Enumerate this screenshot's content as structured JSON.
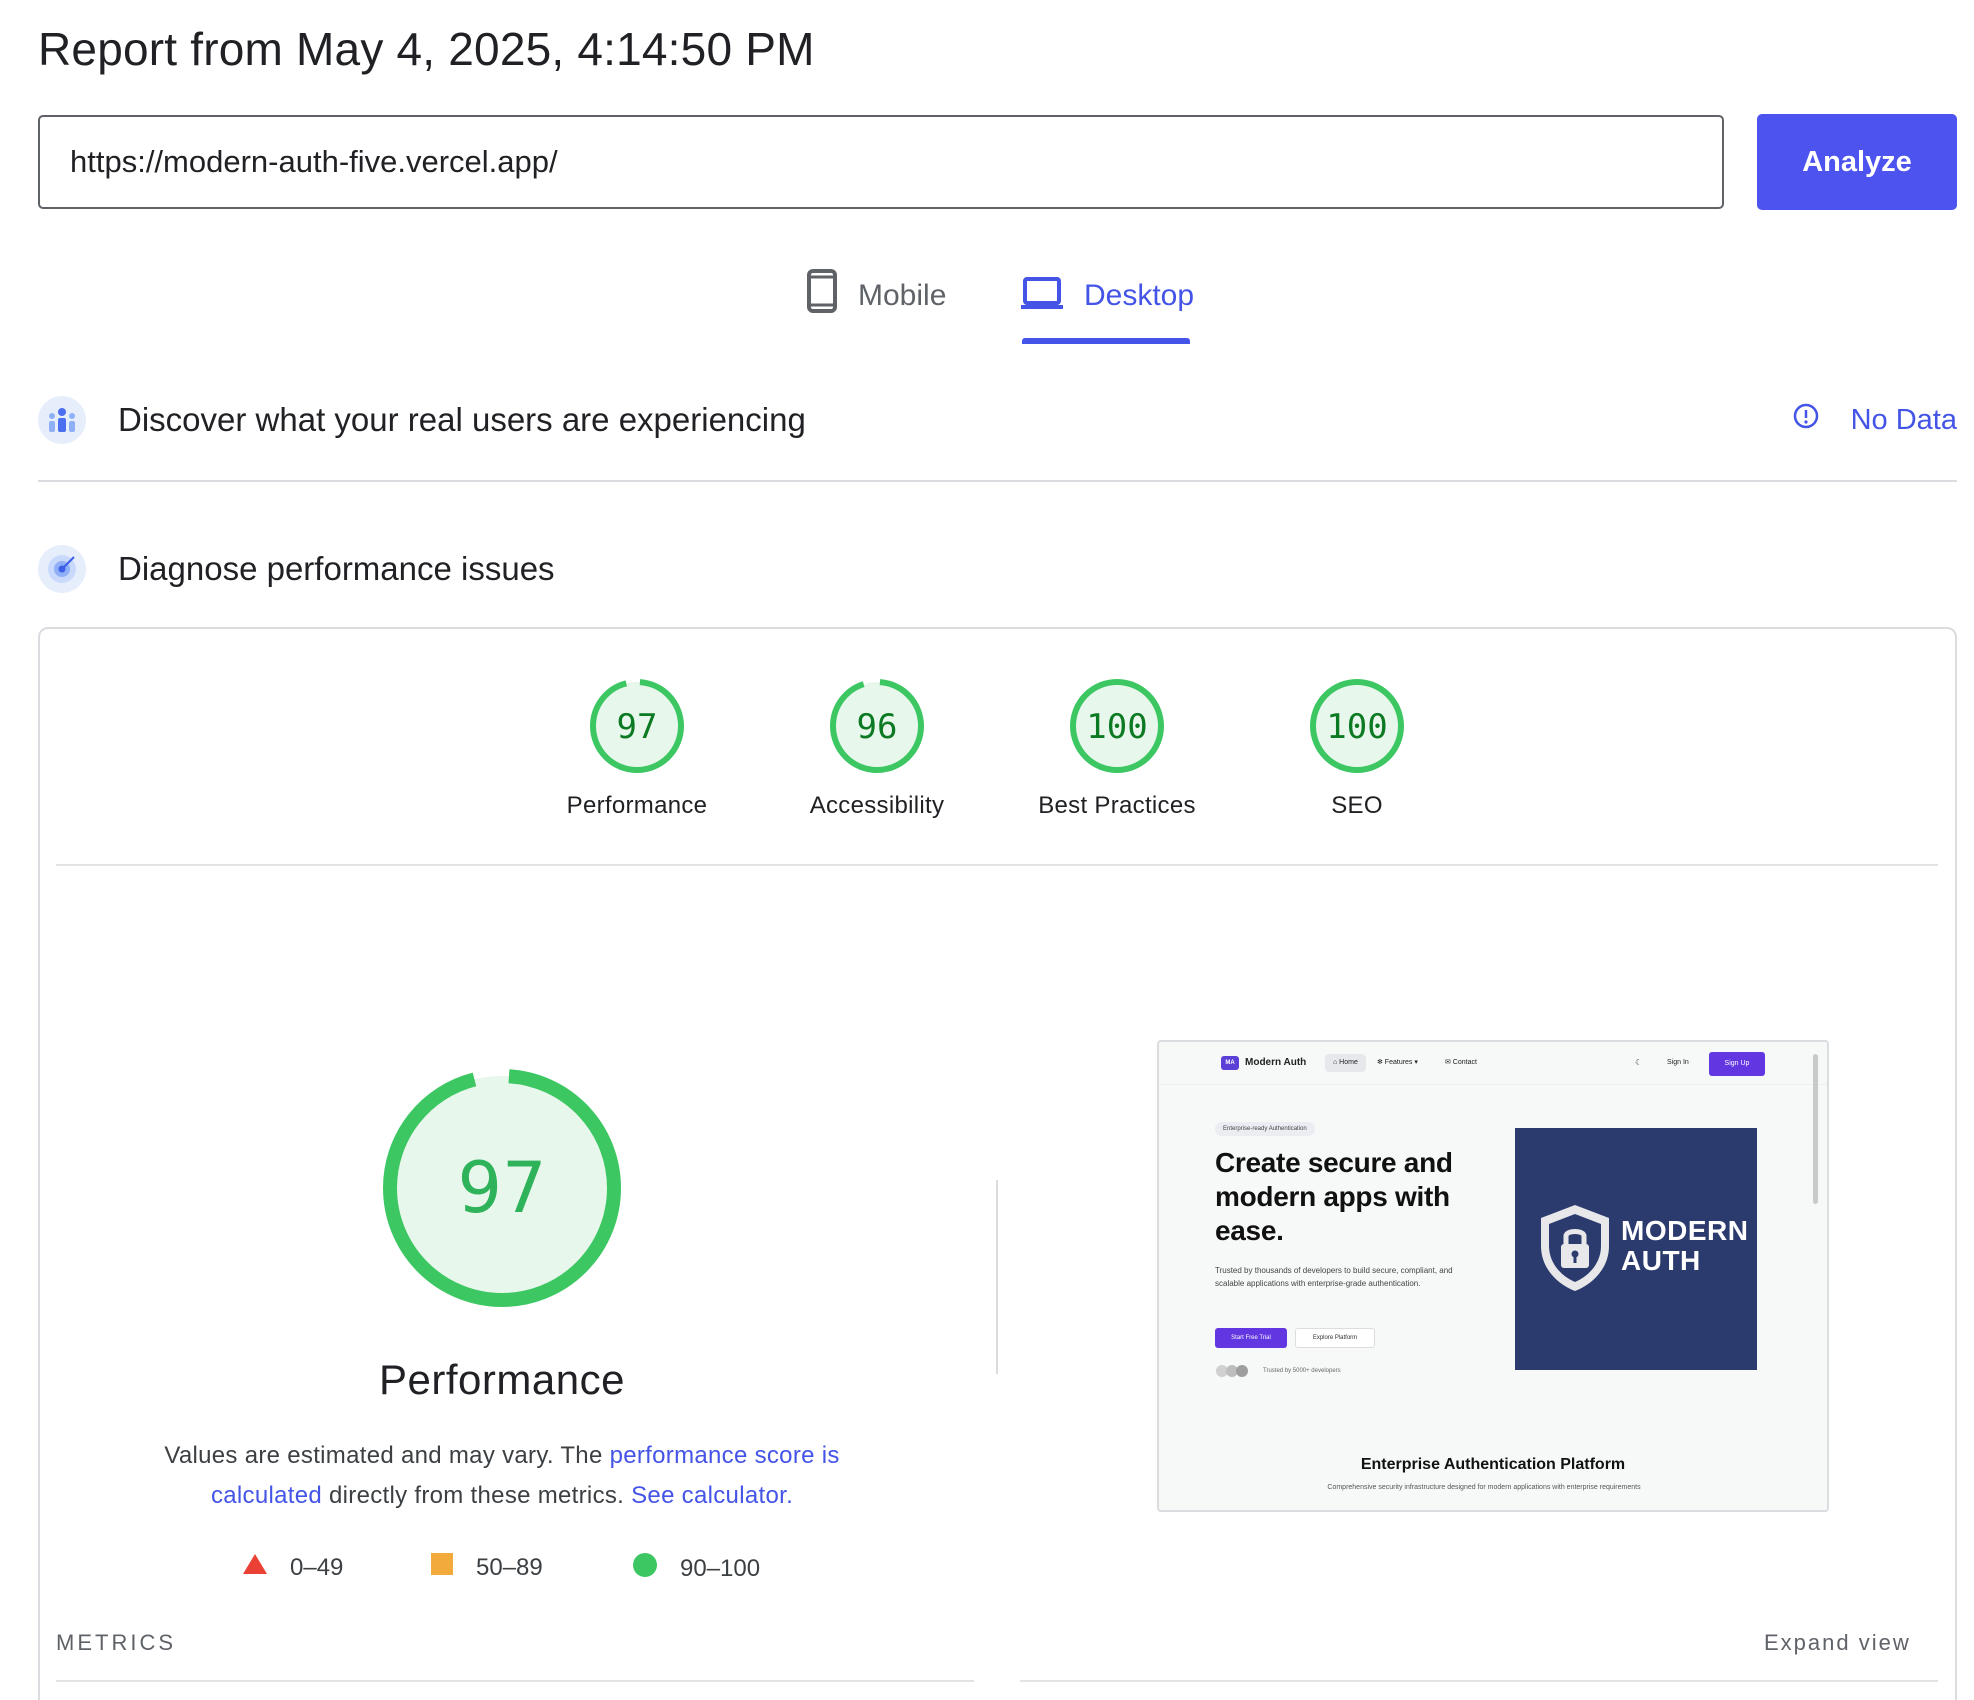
{
  "report_title": "Report from May 4, 2025, 4:14:50 PM",
  "url_input": {
    "value": "https://modern-auth-five.vercel.app/"
  },
  "analyze_label": "Analyze",
  "tabs": [
    {
      "label": "Mobile",
      "icon": "smartphone-icon",
      "selected": false
    },
    {
      "label": "Desktop",
      "icon": "laptop-icon",
      "selected": true
    }
  ],
  "real_users": {
    "title": "Discover what your real users are experiencing",
    "status": "No Data",
    "status_icon": "info-icon"
  },
  "diagnose": {
    "title": "Diagnose performance issues"
  },
  "scores": [
    {
      "value": "97",
      "label": "Performance",
      "fraction": 0.97
    },
    {
      "value": "96",
      "label": "Accessibility",
      "fraction": 0.96
    },
    {
      "value": "100",
      "label": "Best Practices",
      "fraction": 1.0
    },
    {
      "value": "100",
      "label": "SEO",
      "fraction": 1.0
    }
  ],
  "performance": {
    "score": "97",
    "fraction": 0.97,
    "title": "Performance",
    "desc_part1": "Values are estimated and may vary. The ",
    "desc_link1": "performance score is calculated",
    "desc_part2": " directly from these metrics. ",
    "desc_link2": "See calculator."
  },
  "legend": [
    {
      "range": "0–49",
      "shape": "triangle",
      "color": "#eb4034"
    },
    {
      "range": "50–89",
      "shape": "square",
      "color": "#f2ab3a"
    },
    {
      "range": "90–100",
      "shape": "circle",
      "color": "#3cc762"
    }
  ],
  "metrics_label": "METRICS",
  "expand_view_label": "Expand view",
  "colors": {
    "accent": "#4454e6",
    "analyze_button": "#4c53ef",
    "pass_green": "#3cc762",
    "pass_text": "#0c7a22",
    "gauge_fill": "#e8f7ec"
  },
  "screenshot": {
    "logo_initials": "MA",
    "logo_text": "Modern Auth",
    "nav_home": "⌂ Home",
    "nav_features": "✻ Features ▾",
    "nav_contact": "✉ Contact",
    "nav_theme": "☾",
    "nav_signin": "Sign In",
    "nav_signup": "Sign Up",
    "badge": "Enterprise-ready Authentication",
    "headline": "Create secure and modern apps with ease.",
    "subtext": "Trusted by thousands of developers to build secure, compliant, and scalable applications with enterprise-grade authentication.",
    "cta_primary": "Start Free Trial",
    "cta_secondary": "Explore Platform",
    "trusted": "Trusted by 5000+ developers",
    "hero_line1": "MODERN",
    "hero_line2": "AUTH",
    "section_title": "Enterprise Authentication Platform",
    "section_sub": "Comprehensive security infrastructure designed for modern applications with enterprise requirements"
  }
}
